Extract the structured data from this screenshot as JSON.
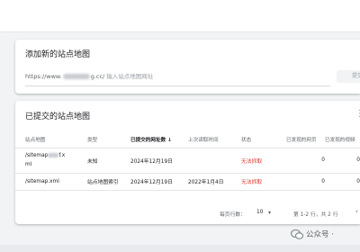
{
  "add_card": {
    "title": "添加新的站点地图",
    "url_prefix": "https://www.",
    "url_domain_visible": "g.cc/",
    "input_placeholder": "输入站点地图网址",
    "submit_label": "提交"
  },
  "list_card": {
    "title": "已提交的站点地图",
    "more_icon": "vertical-dots-icon",
    "columns": [
      {
        "label": "站点地图",
        "sorted": false
      },
      {
        "label": "类型",
        "sorted": false
      },
      {
        "label": "已提交的网址数",
        "sorted": true,
        "sort_direction": "desc"
      },
      {
        "label": "上次读取时间",
        "sorted": false
      },
      {
        "label": "状态",
        "sorted": false
      },
      {
        "label": "已发现的网页",
        "sorted": false
      },
      {
        "label": "已发现的视频",
        "sorted": false
      }
    ],
    "rows": [
      {
        "sitemap_line1": "/sitemap",
        "sitemap_line1_tail": "f.x",
        "sitemap_line2": "ml",
        "type": "未知",
        "submitted": "2024年12月19日",
        "last_read": "",
        "status": "无法抓取",
        "pages": "0",
        "videos": "0"
      },
      {
        "sitemap_line1": "/sitemap.xml",
        "type": "站点地图索引",
        "submitted": "2024年12月19日",
        "last_read": "2022年1月4日",
        "status": "无法抓取",
        "pages": "0",
        "videos": "0"
      }
    ],
    "pagination": {
      "rows_per_page_label": "每页行数：",
      "rows_per_page_value": "10",
      "range_text": "第 1-2 行，共 2 行"
    }
  },
  "watermark": {
    "text": "公众号 ·"
  },
  "colors": {
    "error_status": "#d93025",
    "background": "#f1f3f4",
    "card": "#ffffff"
  }
}
